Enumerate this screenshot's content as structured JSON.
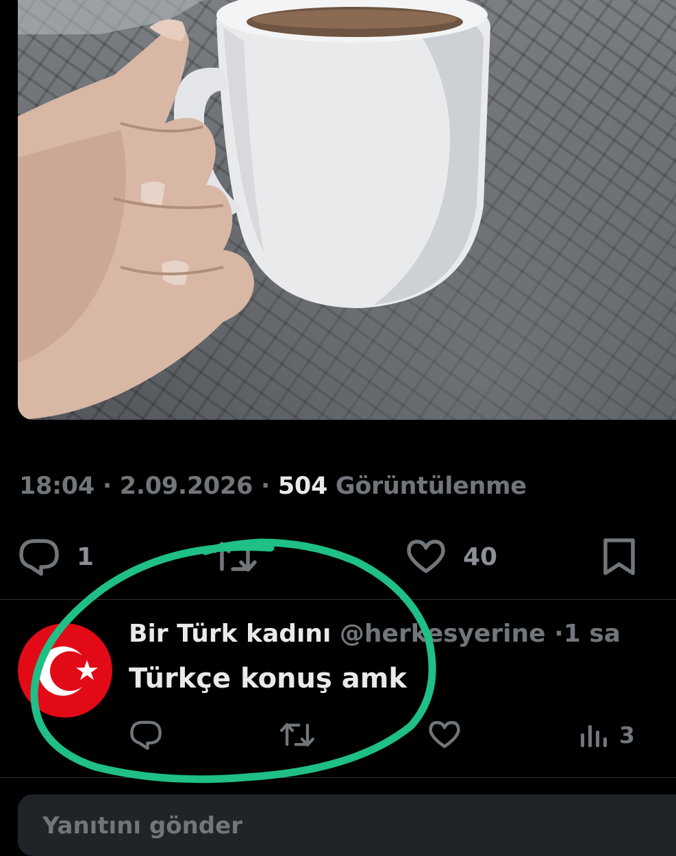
{
  "tweet": {
    "photo_alt": "",
    "time": "18:04",
    "separator": "·",
    "date": "2.09.2026",
    "views_count": "504",
    "views_label": "Görüntülenme",
    "actions": {
      "reply_count": "1",
      "like_count": "40"
    }
  },
  "reply": {
    "display_name": "Bir Türk kadını",
    "handle": "@herkesyerine",
    "separator": "·",
    "time": "1 sa",
    "text": "Türkçe konuş amk",
    "views_count": "3"
  },
  "composer": {
    "placeholder": "Yanıtını gönder"
  },
  "colors": {
    "background": "#000000",
    "text_primary": "#e7e9ea",
    "text_secondary": "#71767b",
    "divider": "#2f3336",
    "annotation_green": "#1fbf86",
    "flag_red": "#e30a17"
  },
  "icons": {
    "reply": "reply-icon",
    "retweet": "retweet-icon",
    "like": "heart-icon",
    "bookmark": "bookmark-icon",
    "views": "views-icon"
  }
}
